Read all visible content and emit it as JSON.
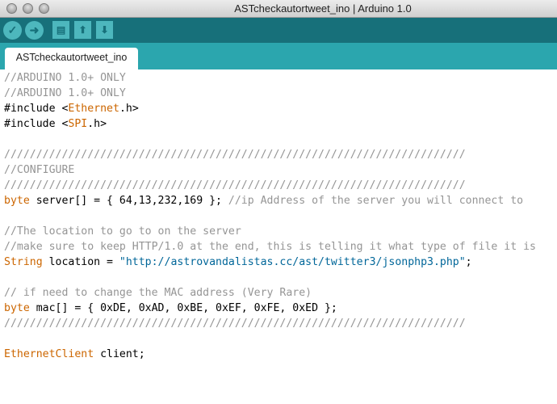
{
  "window": {
    "title": "ASTcheckautortweet_ino | Arduino 1.0"
  },
  "toolbar": {
    "verify_icon": "✓",
    "upload_icon": "➜",
    "new_icon": "▤",
    "open_icon": "⬆",
    "save_icon": "⬇"
  },
  "tabs": [
    {
      "label": "ASTcheckautortweet_ino"
    }
  ],
  "colors": {
    "comment": "#959595",
    "keyword": "#cc6600",
    "string": "#006699",
    "toolbar": "#17707a",
    "tabbar": "#2ba6ae"
  },
  "code": [
    [
      {
        "t": "//ARDUINO 1.0+ ONLY",
        "c": "comment"
      }
    ],
    [
      {
        "t": "//ARDUINO 1.0+ ONLY",
        "c": "comment"
      }
    ],
    [
      {
        "t": "#include <",
        "c": "plain"
      },
      {
        "t": "Ethernet",
        "c": "kw"
      },
      {
        "t": ".h>",
        "c": "plain"
      }
    ],
    [
      {
        "t": "#include <",
        "c": "plain"
      },
      {
        "t": "SPI",
        "c": "kw"
      },
      {
        "t": ".h>",
        "c": "plain"
      }
    ],
    [],
    [
      {
        "t": "////////////////////////////////////////////////////////////////////////",
        "c": "comment"
      }
    ],
    [
      {
        "t": "//CONFIGURE",
        "c": "comment"
      }
    ],
    [
      {
        "t": "////////////////////////////////////////////////////////////////////////",
        "c": "comment"
      }
    ],
    [
      {
        "t": "byte",
        "c": "kw"
      },
      {
        "t": " server[] = { 64,13,232,169 }; ",
        "c": "plain"
      },
      {
        "t": "//ip Address of the server you will connect to",
        "c": "comment"
      }
    ],
    [],
    [
      {
        "t": "//The location to go to on the server",
        "c": "comment"
      }
    ],
    [
      {
        "t": "//make sure to keep HTTP/1.0 at the end, this is telling it what type of file it is",
        "c": "comment"
      }
    ],
    [
      {
        "t": "String",
        "c": "kw"
      },
      {
        "t": " location = ",
        "c": "plain"
      },
      {
        "t": "\"http://astrovandalistas.cc/ast/twitter3/jsonphp3.php\"",
        "c": "str"
      },
      {
        "t": ";",
        "c": "plain"
      }
    ],
    [],
    [
      {
        "t": "// if need to change the MAC address (Very Rare)",
        "c": "comment"
      }
    ],
    [
      {
        "t": "byte",
        "c": "kw"
      },
      {
        "t": " mac[] = { 0xDE, 0xAD, 0xBE, 0xEF, 0xFE, 0xED };",
        "c": "plain"
      }
    ],
    [
      {
        "t": "////////////////////////////////////////////////////////////////////////",
        "c": "comment"
      }
    ],
    [],
    [
      {
        "t": "EthernetClient",
        "c": "kw"
      },
      {
        "t": " client;",
        "c": "plain"
      }
    ]
  ]
}
